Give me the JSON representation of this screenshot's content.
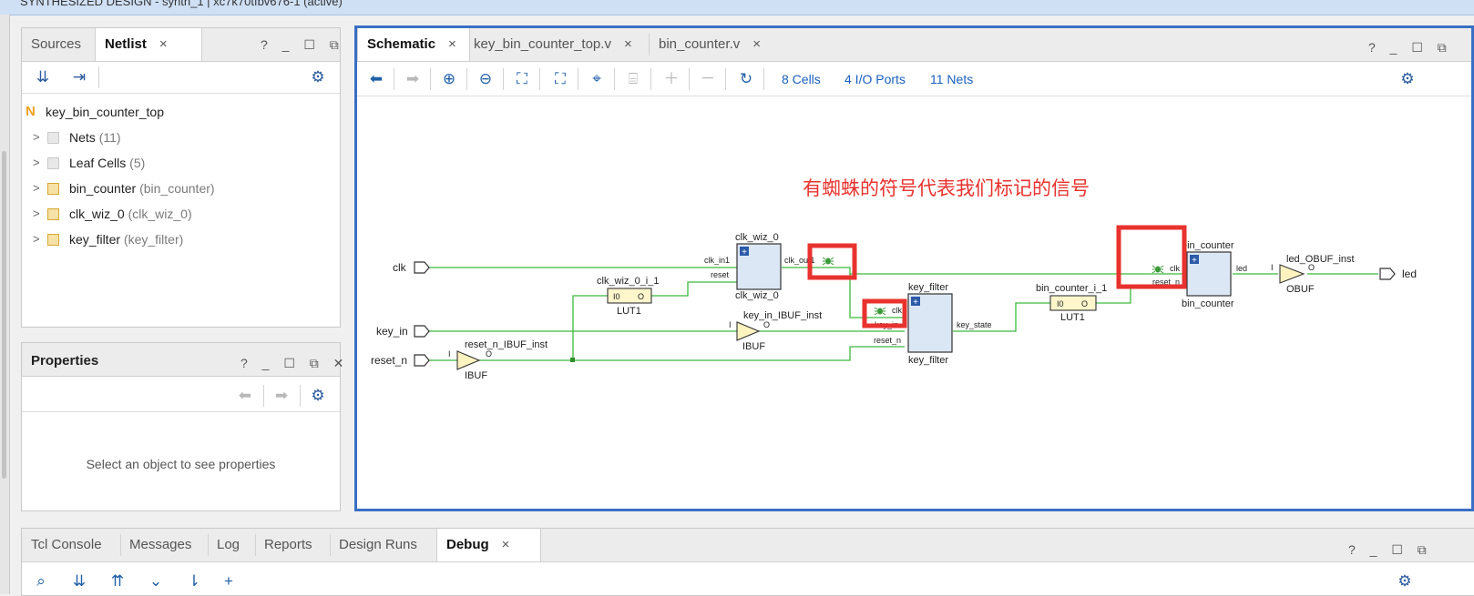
{
  "window": {
    "title": "SYNTHESIZED DESIGN - synth_1 | xc7k70tfbv676-1 (active)"
  },
  "left_panel": {
    "tabs": [
      {
        "label": "Sources"
      },
      {
        "label": "Netlist"
      }
    ],
    "close": "×",
    "window_controls": "? _ ☐ ⧉",
    "tree": {
      "root": {
        "badge": "N",
        "label": "key_bin_counter_top"
      },
      "items": [
        {
          "label": "Nets",
          "extra": "(11)",
          "icon": "folder-icon"
        },
        {
          "label": "Leaf Cells",
          "extra": "(5)",
          "icon": "folder-icon"
        },
        {
          "label": "bin_counter",
          "extra": "(bin_counter)",
          "icon": "cell-icon"
        },
        {
          "label": "clk_wiz_0",
          "extra": "(clk_wiz_0)",
          "icon": "cell-icon"
        },
        {
          "label": "key_filter",
          "extra": "(key_filter)",
          "icon": "cell-icon"
        }
      ]
    }
  },
  "properties_panel": {
    "title": "Properties",
    "window_controls": "? _ ☐ ⧉ ✕",
    "empty_message": "Select an object to see properties"
  },
  "editor": {
    "tabs": [
      {
        "label": "Schematic",
        "active": true
      },
      {
        "label": "key_bin_counter_top.v",
        "active": false
      },
      {
        "label": "bin_counter.v",
        "active": false
      }
    ],
    "close": "×",
    "window_controls": "? _ ☐ ⧉",
    "toolbar": {
      "cells": "8 Cells",
      "io_ports": "4 I/O Ports",
      "nets": "11 Nets"
    },
    "annotation": "有蜘蛛的符号代表我们标记的信号",
    "annotation_color": "#e8322e",
    "schematic": {
      "ports": {
        "clk": "clk",
        "key_in": "key_in",
        "reset_n": "reset_n",
        "led": "led"
      },
      "clk_wiz": {
        "name": "clk_wiz_0",
        "type": "clk_wiz_0",
        "pin_in": "clk_in1",
        "pin_reset": "reset",
        "pin_out": "clk_out1"
      },
      "lut_clk": {
        "name": "clk_wiz_0_i_1",
        "type": "LUT1",
        "pin_i": "I0",
        "pin_o": "O"
      },
      "key_ibuf": {
        "name": "key_in_IBUF_inst",
        "type": "IBUF",
        "pin_i": "I",
        "pin_o": "O"
      },
      "reset_ibuf": {
        "name": "reset_n_IBUF_inst",
        "type": "IBUF",
        "pin_i": "I",
        "pin_o": "O"
      },
      "key_filter": {
        "name": "key_filter",
        "type": "key_filter",
        "pin_clk": "clk",
        "pin_key": "key_in",
        "pin_reset": "reset_n",
        "pin_out": "key_state"
      },
      "lut_bin": {
        "name": "bin_counter_i_1",
        "type": "LUT1",
        "pin_i": "I0",
        "pin_o": "O"
      },
      "bin_counter": {
        "name": "bin_counter",
        "type": "bin_counter",
        "pin_clk": "clk",
        "pin_reset": "reset_n",
        "pin_out": "led"
      },
      "obuf": {
        "name": "led_OBUF_inst",
        "type": "OBUF",
        "pin_i": "I",
        "pin_o": "O"
      },
      "wire_color": "#3cb93c",
      "cell_fill": "#dce7f5",
      "highlight_color": "#e8322e"
    }
  },
  "bottom_panel": {
    "tabs": [
      {
        "label": "Tcl Console"
      },
      {
        "label": "Messages"
      },
      {
        "label": "Log"
      },
      {
        "label": "Reports"
      },
      {
        "label": "Design Runs"
      },
      {
        "label": "Debug"
      }
    ],
    "close": "×",
    "window_controls": "? _ ☐ ⧉"
  }
}
